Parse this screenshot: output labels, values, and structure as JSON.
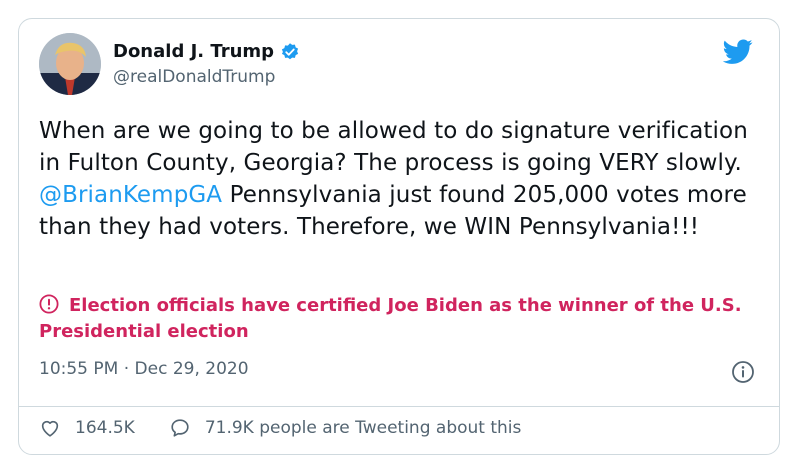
{
  "tweet": {
    "author_name": "Donald J. Trump",
    "handle": "@realDonaldTrump",
    "text_part1": "When are we going to be allowed to do signature verification in Fulton County, Georgia? The process is going VERY slowly. ",
    "mention": "@BrianKempGA",
    "text_part2": " Pennsylvania just found 205,000 votes more than they had voters. Therefore, we WIN Pennsylvania!!!",
    "notice": "Election officials have certified Joe Biden as the winner of the U.S. Presidential election",
    "timestamp": "10:55 PM · Dec 29, 2020"
  },
  "footer": {
    "likes": "164.5K",
    "comments_label": "71.9K people are Tweeting about this"
  },
  "colors": {
    "mention": "#1d9bf0",
    "notice": "#d0245e",
    "verified": "#1d9bf0",
    "muted": "#536471"
  },
  "icons": {
    "verified": "verified-badge-icon",
    "brand": "twitter-bird-icon",
    "notice": "exclamation-circle-icon",
    "info": "info-icon",
    "like": "heart-icon",
    "reply": "speech-bubble-icon"
  }
}
